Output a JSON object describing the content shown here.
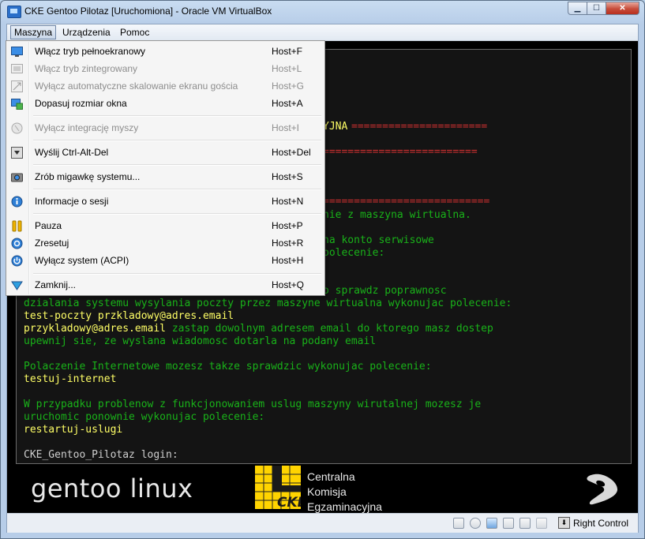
{
  "window": {
    "title": "CKE Gentoo Pilotaz [Uruchomiona] - Oracle VM VirtualBox",
    "minimize_glyph": "▁",
    "maximize_glyph": "☐",
    "close_glyph": "✕"
  },
  "menubar": {
    "items": [
      {
        "label": "Maszyna",
        "active": true
      },
      {
        "label": "Urządzenia",
        "active": false
      },
      {
        "label": "Pomoc",
        "active": false
      }
    ]
  },
  "machine_menu": {
    "items": [
      {
        "label": "Włącz tryb pełnoekranowy",
        "shortcut": "Host+F",
        "enabled": true,
        "icon": "fullscreen-icon"
      },
      {
        "label": "Włącz tryb zintegrowany",
        "shortcut": "Host+L",
        "enabled": false,
        "icon": "seamless-icon"
      },
      {
        "label": "Wyłącz automatyczne skalowanie ekranu gościa",
        "shortcut": "Host+G",
        "enabled": false,
        "icon": "scale-icon"
      },
      {
        "label": "Dopasuj rozmiar okna",
        "shortcut": "Host+A",
        "enabled": true,
        "icon": "adjust-window-icon"
      },
      {
        "label": "Wyłącz integrację myszy",
        "shortcut": "Host+I",
        "enabled": false,
        "icon": "mouse-integration-icon"
      },
      {
        "label": "Wyślij Ctrl-Alt-Del",
        "shortcut": "Host+Del",
        "enabled": true,
        "icon": "ctrl-alt-del-icon"
      },
      {
        "label": "Zrób migawkę systemu...",
        "shortcut": "Host+S",
        "enabled": true,
        "icon": "snapshot-icon"
      },
      {
        "label": "Informacje o sesji",
        "shortcut": "Host+N",
        "enabled": true,
        "icon": "session-info-icon"
      },
      {
        "label": "Pauza",
        "shortcut": "Host+P",
        "enabled": true,
        "icon": "pause-icon"
      },
      {
        "label": "Zresetuj",
        "shortcut": "Host+R",
        "enabled": true,
        "icon": "reset-icon"
      },
      {
        "label": "Wyłącz system (ACPI)",
        "shortcut": "Host+H",
        "enabled": true,
        "icon": "acpi-shutdown-icon"
      },
      {
        "label": "Zamknij...",
        "shortcut": "Host+Q",
        "enabled": true,
        "icon": "close-vm-icon"
      }
    ]
  },
  "console": {
    "lines": [
      {
        "text": "YJNA",
        "color": "yellow"
      },
      {
        "text": "======================",
        "color": "red"
      },
      {
        "text": "=========================",
        "color": "red"
      },
      {
        "text": "===========================",
        "color": "red"
      },
      {
        "text": "nie z maszyna wirtualna.",
        "color": "green"
      },
      {
        "text": "na konto serwisowe",
        "color": "green"
      },
      {
        "text": "polecenie:",
        "color": "green"
      },
      {
        "text": "o sprawdz poprawnosc",
        "color": "green"
      },
      {
        "text": "dzialania systemu wysylania poczty przez maszyne wirtualna wykonujac polecenie:",
        "color": "green"
      },
      {
        "text": "test-poczty przkladowy@adres.email",
        "color": "yellow"
      },
      {
        "text": "przykladowy@adres.email",
        "color": "yellow"
      },
      {
        "text": " zastap dowolnym adresem email do ktorego masz dostep",
        "color": "green"
      },
      {
        "text": "upewnij sie, ze wyslana wiadomosc dotarla na podany email",
        "color": "green"
      },
      {
        "text": "Polaczenie Internetowe mozesz takze sprawdzic wykonujac polecenie:",
        "color": "green"
      },
      {
        "text": "testuj-internet",
        "color": "yellow"
      },
      {
        "text": "W przypadku problenow z funkcjonowaniem uslug maszyny wirutalnej mozesz je",
        "color": "green"
      },
      {
        "text": "uruchomic ponownie wykonujac polecenie:",
        "color": "green"
      },
      {
        "text": "restartuj-uslugi",
        "color": "yellow"
      },
      {
        "text": "CKE_Gentoo_Pilotaz login:",
        "color": "gray"
      }
    ]
  },
  "branding": {
    "gentoo_text": "gentoo linux",
    "cke_logo_text": "CKE",
    "cke_lines": [
      "Centralna",
      "Komisja",
      "Egzaminacyjna"
    ]
  },
  "statusbar": {
    "icons": [
      "hard-disk-icon",
      "optical-drive-icon",
      "network-icon",
      "usb-icon",
      "shared-folders-icon",
      "capture-icon",
      "mouse-icon",
      "keyboard-icon"
    ],
    "host_key": "Right Control"
  }
}
